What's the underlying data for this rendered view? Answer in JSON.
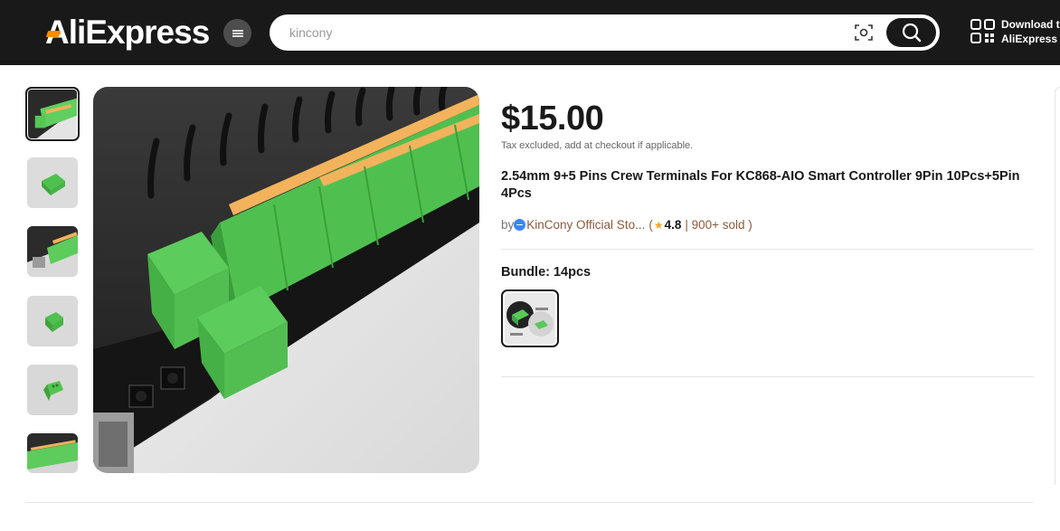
{
  "header": {
    "logo_text": "AliExpress",
    "search": {
      "value": "",
      "placeholder": "kincony"
    },
    "download": {
      "line1": "Download the",
      "line2": "AliExpress app"
    }
  },
  "product": {
    "price": "$15.00",
    "tax_note": "Tax excluded, add at checkout if applicable.",
    "title": "2.54mm 9+5 Pins Crew Terminals For KC868-AIO Smart Controller 9Pin 10Pcs+5Pin 4Pcs",
    "by": "by",
    "store_name": "KinCony Official Sto...",
    "open_paren": "(",
    "rating": "4.8",
    "sold": "| 900+ sold )",
    "bundle_label": "Bundle: 14pcs"
  },
  "gallery": {
    "thumbnail_count": 6,
    "selected_index": 0
  },
  "colors": {
    "header_bg": "#191919",
    "brand_accent": "#ff8a00",
    "store_link": "#8a5a3c",
    "star": "#f5a623"
  }
}
